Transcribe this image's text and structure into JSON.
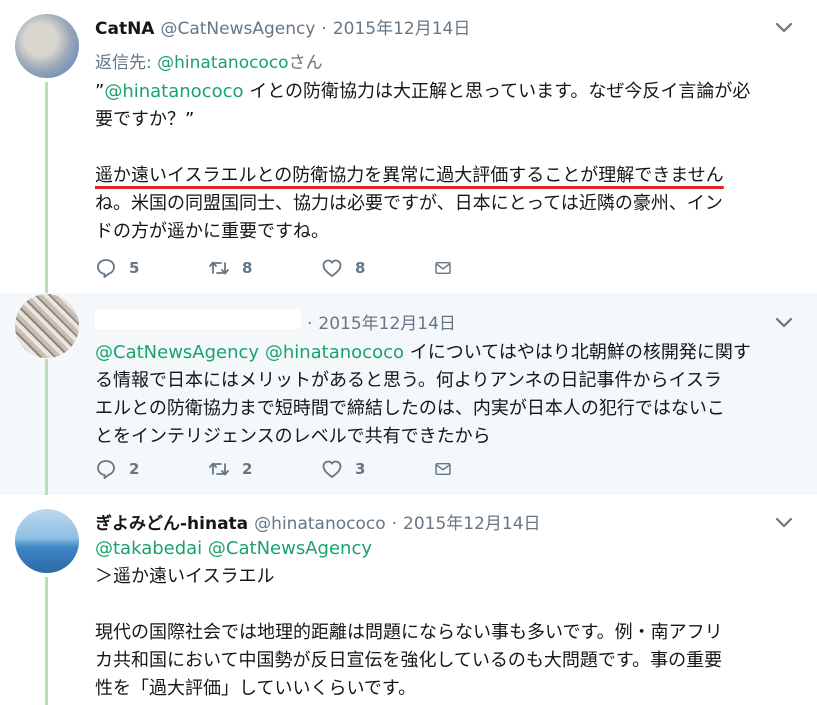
{
  "tweets": [
    {
      "name": "CatNA",
      "handle": "@CatNewsAgency",
      "date": "2015年12月14日",
      "replying_label": "返信先: ",
      "replying_to": "@hinatanococo",
      "replying_suffix": "さん",
      "body": {
        "line1_quote_open": "”",
        "line1_mention": "@hinatanococo",
        "line1_text": " イとの防衛協力は大正解と思っています。なぜ今反イ言論が必",
        "line2_text": "要ですか？”",
        "underlined": "遥か遠いイスラエルとの防衛協力を異常に過大評価することが理解できません",
        "line4_text": "ね。米国の同盟国同士、協力は必要ですが、日本にとっては近隣の豪州、イン",
        "line5_text": "ドの方が遥かに重要ですね。"
      },
      "replies": "5",
      "retweets": "8",
      "likes": "8"
    },
    {
      "name": "",
      "handle": "",
      "date": "2015年12月14日",
      "body": {
        "mention1": "@CatNewsAgency",
        "mention2": "@hinatanococo",
        "line1_text": " イについてはやはり北朝鮮の核開発に関す",
        "line2_text": "る情報で日本にはメリットがあると思う。何よりアンネの日記事件からイスラ",
        "line3_text": "エルとの防衛協力まで短時間で締結したのは、内実が日本人の犯行ではないこ",
        "line4_text": "とをインテリジェンスのレベルで共有できたから"
      },
      "replies": "2",
      "retweets": "2",
      "likes": "3"
    },
    {
      "name": "ぎよみどん-hinata",
      "handle": "@hinatanococo",
      "date": "2015年12月14日",
      "body": {
        "mention1": "@takabedai",
        "mention2": "@CatNewsAgency",
        "quote_line": "＞遥か遠いイスラエル",
        "line1_text": "現代の国際社会では地理的距離は問題にならない事も多いです。例・南アフリ",
        "line2_text": "カ共和国において中国勢が反日宣伝を強化しているのも大問題です。事の重要",
        "line3_text": "性を「過大評価」していいくらいです。"
      }
    }
  ],
  "icons": {
    "reply": "reply-icon",
    "retweet": "retweet-icon",
    "like": "heart-icon",
    "dm": "envelope-icon",
    "menu": "chevron-down-icon"
  },
  "colors": {
    "mention": "#19a36b",
    "muted": "#657786",
    "connector": "#b8dfaf",
    "highlight_underline": "#e0202a"
  }
}
